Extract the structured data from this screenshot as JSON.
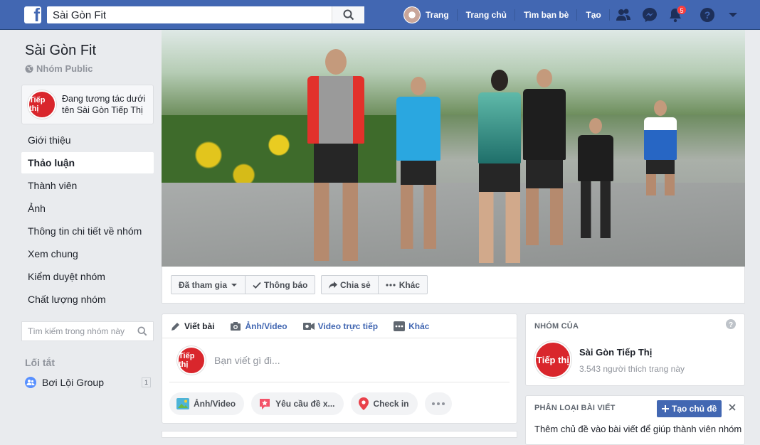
{
  "topbar": {
    "logo": "f",
    "search_value": "Sài Gòn Fit",
    "profile_label": "Trang",
    "home_label": "Trang chủ",
    "find_friends_label": "Tìm bạn bè",
    "create_label": "Tạo",
    "notifications_count": "5"
  },
  "sidebar": {
    "group_name": "Sài Gòn Fit",
    "group_type": "Nhóm Public",
    "acting_as": "Đang tương tác dưới tên Sài Gòn Tiếp Thị",
    "logo_text": "Tiếp thị",
    "items": [
      {
        "label": "Giới thiệu"
      },
      {
        "label": "Thảo luận"
      },
      {
        "label": "Thành viên"
      },
      {
        "label": "Ảnh"
      },
      {
        "label": "Thông tin chi tiết về nhóm"
      },
      {
        "label": "Xem chung"
      },
      {
        "label": "Kiểm duyệt nhóm"
      },
      {
        "label": "Chất lượng nhóm"
      }
    ],
    "search_placeholder": "Tìm kiếm trong nhóm này",
    "shortcuts_title": "Lối tắt",
    "shortcut": {
      "label": "Bơi Lội Group",
      "count": "1"
    }
  },
  "actionbar": {
    "joined": "Đã tham gia",
    "notifications": "Thông báo",
    "share": "Chia sẻ",
    "more": "Khác"
  },
  "composer": {
    "tabs": [
      "Viết bài",
      "Ảnh/Video",
      "Video trực tiếp",
      "Khác"
    ],
    "placeholder": "Bạn viết gì đi...",
    "actions": [
      "Ảnh/Video",
      "Yêu cầu đề x...",
      "Check in"
    ]
  },
  "page_card": {
    "heading": "NHÓM CỦA",
    "page_name": "Sài Gòn Tiếp Thị",
    "likes": "3.543 người thích trang này"
  },
  "topics_card": {
    "heading": "PHÂN LOẠI BÀI VIẾT",
    "create_button": "Tạo chủ đề",
    "description": "Thêm chủ đề vào bài viết để giúp thành viên nhóm"
  }
}
